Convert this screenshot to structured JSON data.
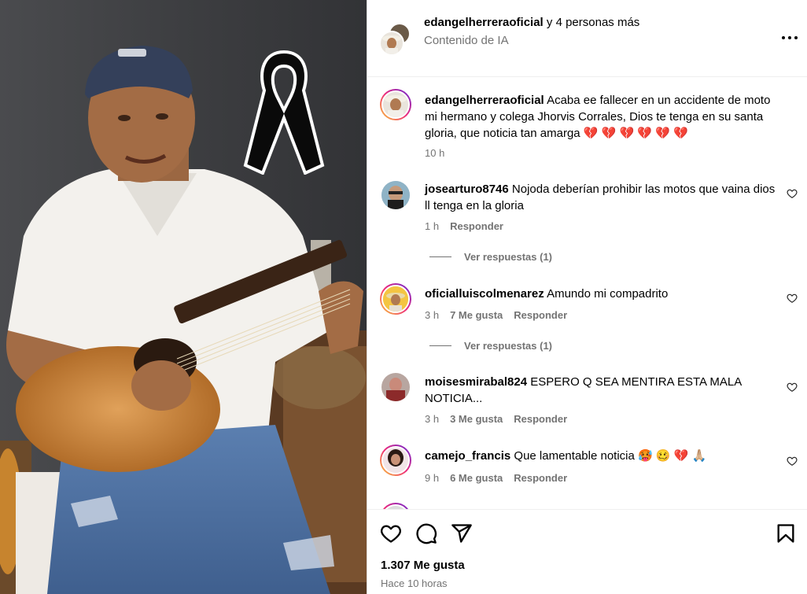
{
  "header": {
    "username": "edangelherreraoficial",
    "collab_text": " y 4 personas más",
    "subtitle": "Contenido de IA",
    "more_icon": "more-horizontal-icon"
  },
  "caption": {
    "username": "edangelherreraoficial",
    "text": " Acaba ee fallecer en un accidente de moto mi hermano y colega Jhorvis Corrales, Dios te tenga en su santa gloria, que noticia tan amarga 💔 💔 💔 💔 💔 💔",
    "time": "10 h"
  },
  "comments": [
    {
      "username": "josearturo8746",
      "text": " Nojoda deberían prohibir las motos que vaina dios ll tenga en la gloria",
      "time": "1 h",
      "likes": "",
      "reply_label": "Responder",
      "view_replies": "Ver respuestas (1)"
    },
    {
      "username": "oficialluiscolmenarez",
      "text": " Amundo mi compadrito",
      "time": "3 h",
      "likes": "7 Me gusta",
      "reply_label": "Responder",
      "view_replies": "Ver respuestas (1)"
    },
    {
      "username": "moisesmirabal824",
      "text": " ESPERO Q SEA MENTIRA ESTA MALA NOTICIA...",
      "time": "3 h",
      "likes": "3 Me gusta",
      "reply_label": "Responder",
      "view_replies": ""
    },
    {
      "username": "camejo_francis",
      "text": " Que lamentable noticia 🥵 🥴 💔 🙏🏼",
      "time": "9 h",
      "likes": "6 Me gusta",
      "reply_label": "Responder",
      "view_replies": ""
    }
  ],
  "actions": {
    "like_icon": "heart-icon",
    "comment_icon": "comment-icon",
    "share_icon": "send-icon",
    "save_icon": "bookmark-icon"
  },
  "likes_count": "1.307 Me gusta",
  "posted_ago": "Hace 10 horas",
  "colors": {
    "text_primary": "#000000",
    "text_secondary": "#737373",
    "divider": "#efefef",
    "story_ring": "#ee2a7b"
  }
}
